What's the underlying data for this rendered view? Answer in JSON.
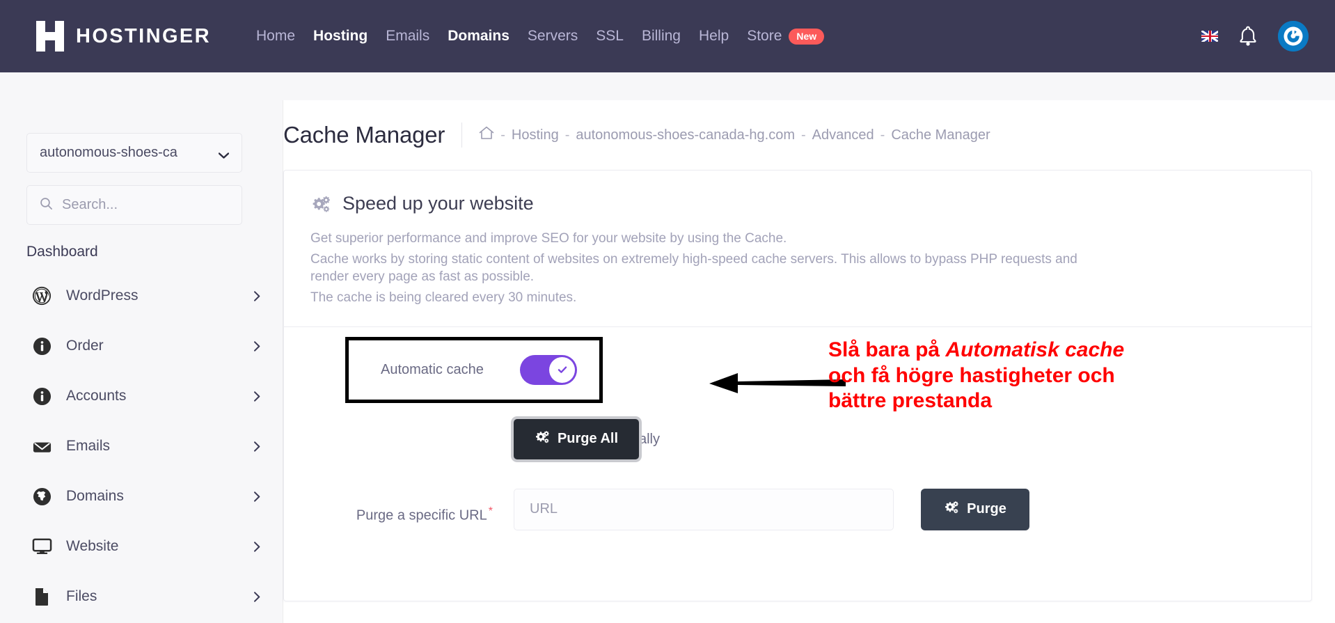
{
  "topnav": {
    "brand": "HOSTINGER",
    "links": [
      {
        "label": "Home",
        "active": false
      },
      {
        "label": "Hosting",
        "active": true
      },
      {
        "label": "Emails",
        "active": false
      },
      {
        "label": "Domains",
        "active": true
      },
      {
        "label": "Servers",
        "active": false
      },
      {
        "label": "SSL",
        "active": false
      },
      {
        "label": "Billing",
        "active": false
      },
      {
        "label": "Help",
        "active": false
      }
    ],
    "store_label": "Store",
    "store_badge": "New",
    "icons": [
      "uk-flag-icon",
      "bell-icon",
      "account-avatar"
    ],
    "background": "#3b3a55",
    "badge_color": "#fc5a5a"
  },
  "sidebar": {
    "site_selector": "autonomous-shoes-ca",
    "search_placeholder": "Search...",
    "search_value": "",
    "section_label": "Dashboard",
    "items": [
      {
        "label": "WordPress",
        "icon": "wordpress-icon"
      },
      {
        "label": "Order",
        "icon": "info-icon"
      },
      {
        "label": "Accounts",
        "icon": "info-icon"
      },
      {
        "label": "Emails",
        "icon": "envelope-icon"
      },
      {
        "label": "Domains",
        "icon": "globe-icon"
      },
      {
        "label": "Website",
        "icon": "monitor-icon"
      },
      {
        "label": "Files",
        "icon": "file-icon"
      }
    ]
  },
  "page": {
    "title": "Cache Manager",
    "breadcrumb": [
      "Hosting",
      "autonomous-shoes-canada-hg.com",
      "Advanced",
      "Cache Manager"
    ],
    "breadcrumb_separator": "-"
  },
  "card": {
    "title": "Speed up your website",
    "icon": "gears-icon",
    "description": [
      "Get superior performance and improve SEO for your website by using the Cache.",
      "Cache works by storing static content of websites on extremely high-speed cache servers. This allows to bypass PHP requests and render every page as fast as possible.",
      "The cache is being cleared every 30 minutes."
    ],
    "automatic_cache": {
      "label": "Automatic cache",
      "state": "on",
      "toggle_color": "#7b45e0"
    },
    "purge_manually": {
      "label": "Purge Manually",
      "button_label": "Purge All"
    },
    "purge_url": {
      "label": "Purge a specific URL",
      "required_marker": "*",
      "input_placeholder": "URL",
      "input_value": "",
      "button_label": "Purge"
    }
  },
  "annotation": {
    "color": "#ff0000",
    "arrow": "left-arrow",
    "line1_pre": "Slå bara på ",
    "line1_em": "Automatisk cache",
    "line2": "och få högre hastigheter och",
    "line3": "bättre prestanda"
  }
}
